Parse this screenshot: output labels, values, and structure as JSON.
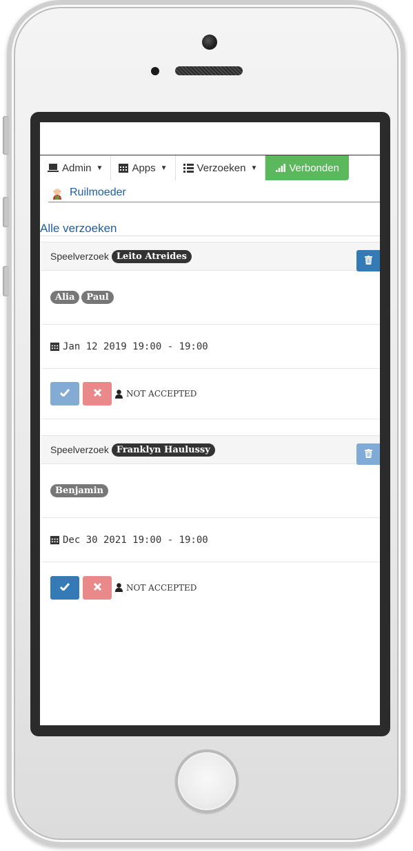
{
  "navbar": {
    "admin_label": "Admin",
    "apps_label": "Apps",
    "requests_label": "Verzoeken",
    "status_label": "Verbonden"
  },
  "user": {
    "name": "Ruilmoeder"
  },
  "section_title": "Alle verzoeken",
  "requests": [
    {
      "type_label": "Speelverzoek",
      "requester": "Leito Atreides",
      "children": [
        "Alia",
        "Paul"
      ],
      "datetime": "Jan 12 2019 19:00 - 19:00",
      "status": "NOT ACCEPTED"
    },
    {
      "type_label": "Speelverzoek",
      "requester": "Franklyn Haulussy",
      "children": [
        "Benjamin"
      ],
      "datetime": "Dec 30 2021 19:00 - 19:00",
      "status": "NOT ACCEPTED"
    }
  ],
  "colors": {
    "primary": "#337ab7",
    "success": "#5cb85c",
    "danger_light": "#e9898a",
    "link": "#1f5ea0"
  }
}
